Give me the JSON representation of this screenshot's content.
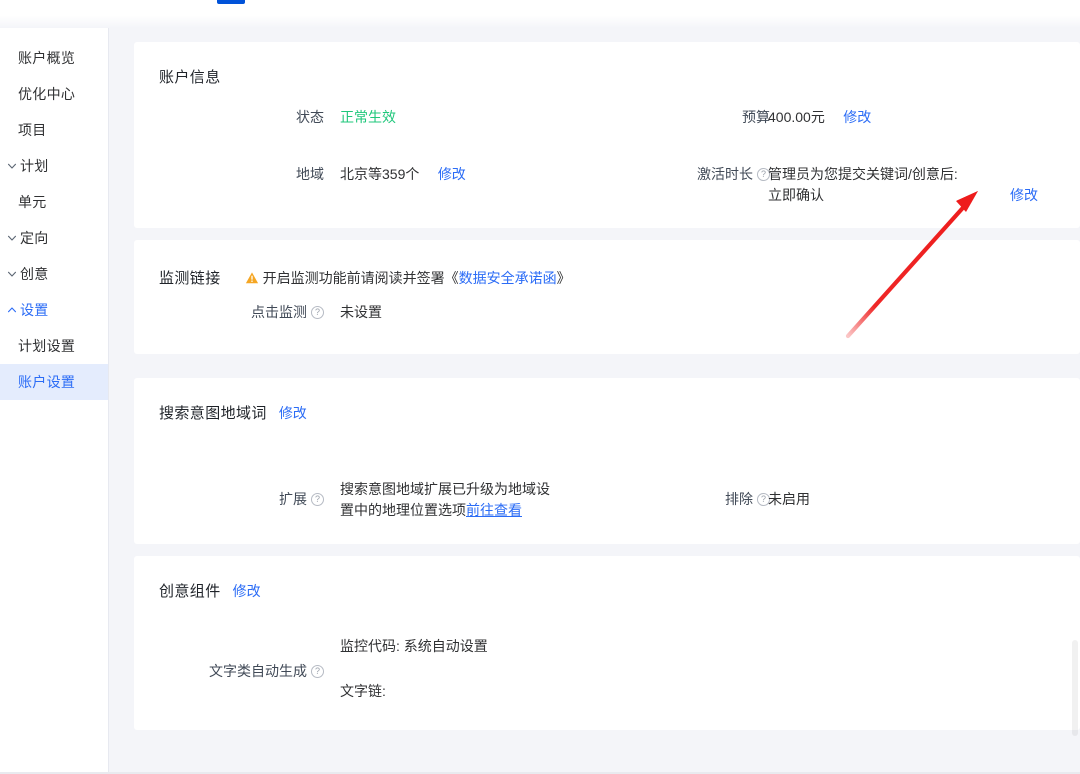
{
  "sidebar": {
    "items": [
      {
        "label": "账户概览",
        "chevron": null,
        "state": "normal",
        "indent": true
      },
      {
        "label": "优化中心",
        "chevron": null,
        "state": "normal",
        "indent": true
      },
      {
        "label": "项目",
        "chevron": null,
        "state": "normal",
        "indent": true
      },
      {
        "label": "计划",
        "chevron": "down",
        "state": "normal",
        "indent": false
      },
      {
        "label": "单元",
        "chevron": null,
        "state": "normal",
        "indent": true
      },
      {
        "label": "定向",
        "chevron": "down",
        "state": "normal",
        "indent": false
      },
      {
        "label": "创意",
        "chevron": "down",
        "state": "normal",
        "indent": false
      },
      {
        "label": "设置",
        "chevron": "up",
        "state": "accent",
        "indent": false
      },
      {
        "label": "计划设置",
        "chevron": null,
        "state": "normal",
        "indent": true
      },
      {
        "label": "账户设置",
        "chevron": null,
        "state": "active",
        "indent": true
      }
    ]
  },
  "colors": {
    "accent": "#2b6cf6",
    "success": "#1fc77b",
    "warning": "#f5a623",
    "annotation": "#ee1c1c",
    "page_bg": "#f4f5f9",
    "tab_indicator": "#0052d9"
  },
  "cards": {
    "account_info": {
      "title": "账户信息",
      "status": {
        "label": "状态",
        "value": "正常生效"
      },
      "budget": {
        "label": "预算",
        "value": "400.00元",
        "action": "修改"
      },
      "region": {
        "label": "地域",
        "value": "北京等359个",
        "action": "修改"
      },
      "activation": {
        "label": "激活时长",
        "help": "?",
        "value_line1": "管理员为您提交关键词/创意后:",
        "value_line2": "立即确认",
        "action": "修改"
      }
    },
    "monitor_link": {
      "title": "监测链接",
      "notice_icon": "warning-triangle-icon",
      "notice_text": "开启监测功能前请阅读并签署《",
      "notice_link": "数据安全承诺函",
      "notice_text_end": "》",
      "click_monitor": {
        "label": "点击监测",
        "help": "?",
        "value": "未设置"
      }
    },
    "search_intent_region": {
      "title": "搜索意图地域词",
      "title_action": "修改",
      "expand": {
        "label": "扩展",
        "help": "?",
        "value_line1": "搜索意图地域扩展已升级为地域设",
        "value_line2": "置中的地理位置选项",
        "value_link": "前往查看"
      },
      "exclude": {
        "label": "排除",
        "help": "?",
        "value": "未启用"
      }
    },
    "creative_components": {
      "title": "创意组件",
      "title_action": "修改",
      "auto_text": {
        "label": "文字类自动生成",
        "help": "?",
        "value_line1": "监控代码: 系统自动设置",
        "value_line2": "文字链:"
      }
    }
  }
}
